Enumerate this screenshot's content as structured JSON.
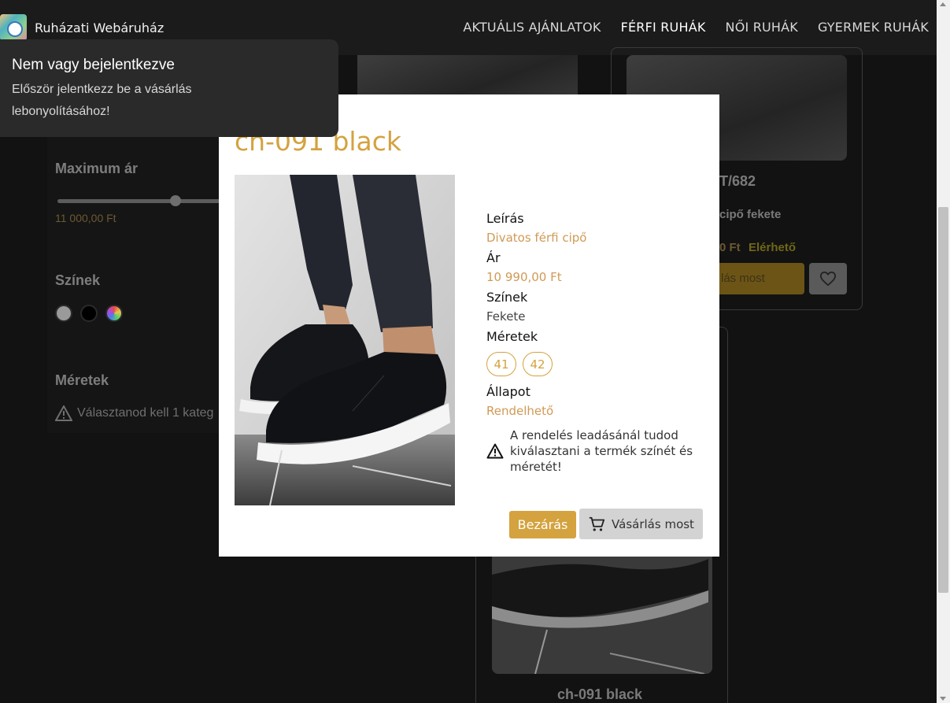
{
  "header": {
    "brand": "Ruházati Webáruház",
    "nav": [
      "AKTUÁLIS AJÁNLATOK",
      "FÉRFI RUHÁK",
      "NŐI RUHÁK",
      "GYERMEK RUHÁK"
    ],
    "active_nav": "FÉRFI RUHÁK"
  },
  "toast": {
    "title": "Nem vagy bejelentkezve",
    "body": "Először jelentkezz be a vásárlás lebonyolításához!"
  },
  "filters": {
    "max_price_label": "Maximum ár",
    "max_price_value": "11 000,00 Ft",
    "colors_label": "Színek",
    "color_swatches": [
      "#9a9a9a",
      "#000000",
      "multicolor"
    ],
    "sizes_label": "Méretek",
    "sizes_warning": "Választanod kell 1 kateg"
  },
  "background_cards": {
    "card1_title_fragment": "T/682",
    "card1_desc_fragment": "cipő fekete",
    "card1_price_fragment": "0 Ft",
    "card1_status": "Elérhető",
    "card1_buy_fragment": "lás most",
    "card2_title": "ch-091 black"
  },
  "modal": {
    "title": "ch-091 black",
    "description_label": "Leírás",
    "description": "Divatos férfi cipő",
    "price_label": "Ár",
    "price": "10 990,00 Ft",
    "colors_label": "Színek",
    "color": "Fekete",
    "sizes_label": "Méretek",
    "sizes": [
      "41",
      "42"
    ],
    "status_label": "Állapot",
    "status": "Rendelhető",
    "notice": "A rendelés leadásánál tudod kiválasztani a termék színét és méretét!",
    "close_button": "Bezárás",
    "buy_button": "Vásárlás most"
  },
  "colors": {
    "accent": "#d4a23e",
    "available": "#c8b02c"
  }
}
